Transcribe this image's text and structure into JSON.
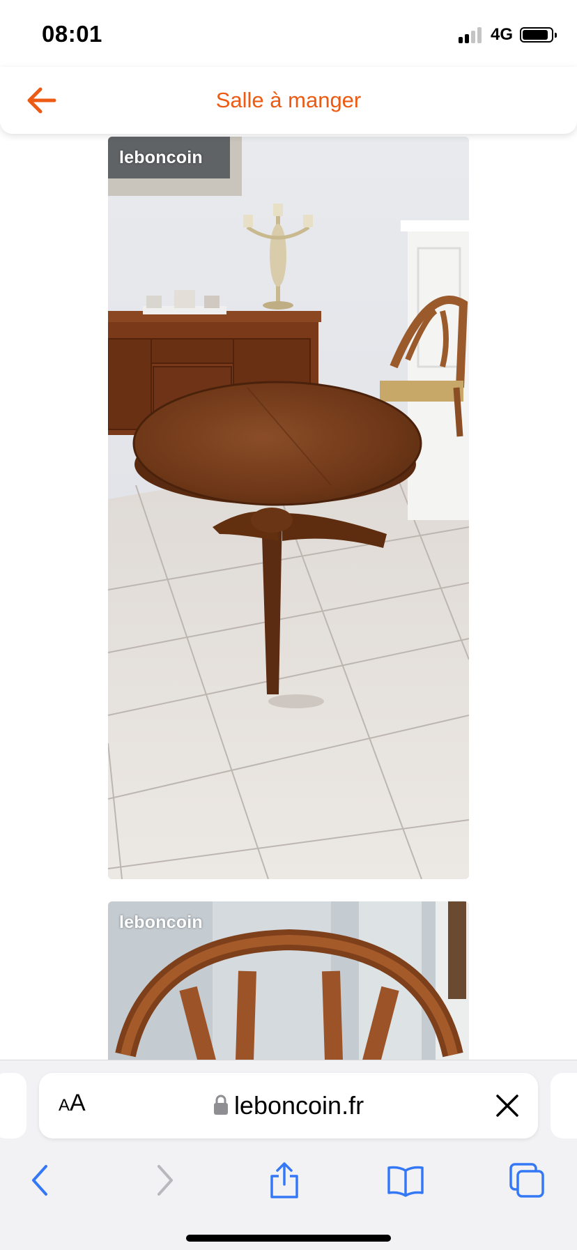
{
  "status_bar": {
    "time": "08:01",
    "network": "4G",
    "signal_bars_active": 2,
    "signal_bars_total": 4
  },
  "header": {
    "title": "Salle à manger",
    "back_icon": "arrow-left-icon",
    "accent_color": "#ec5a13"
  },
  "gallery": {
    "photos": [
      {
        "watermark": "leboncoin",
        "subject": "round wooden pedestal table"
      },
      {
        "watermark": "leboncoin",
        "subject": "wooden chair back"
      }
    ]
  },
  "browser": {
    "text_size_label_small": "A",
    "text_size_label_big": "A",
    "url": "leboncoin.fr",
    "secure_icon": "lock-icon",
    "clear_icon": "close-icon",
    "toolbar_icons": [
      "chevron-left-icon",
      "chevron-right-icon",
      "share-icon",
      "bookmarks-icon",
      "tabs-icon"
    ],
    "tint_color": "#3478f6"
  }
}
